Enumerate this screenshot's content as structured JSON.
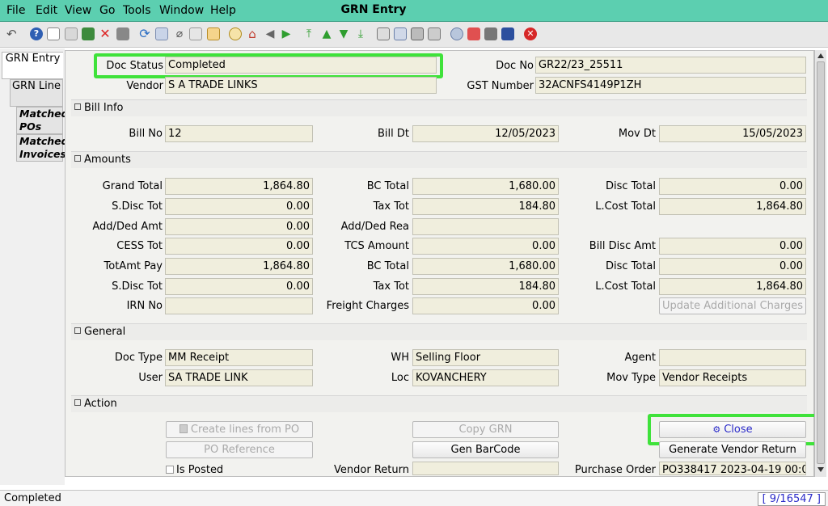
{
  "menu": {
    "file": "File",
    "edit": "Edit",
    "view": "View",
    "go": "Go",
    "tools": "Tools",
    "window": "Window",
    "help": "Help"
  },
  "window_title": "GRN Entry",
  "tabs": [
    "GRN Entry",
    "GRN Line",
    "Matched POs",
    "Matched Invoices"
  ],
  "header": {
    "doc_status_label": "Doc Status",
    "doc_status": "Completed",
    "doc_no_label": "Doc No",
    "doc_no": "GR22/23_25511",
    "vendor_label": "Vendor",
    "vendor": "S A TRADE LINKS",
    "gst_label": "GST Number",
    "gst": "32ACNFS4149P1ZH"
  },
  "bill": {
    "section": "Bill Info",
    "bill_no_label": "Bill No",
    "bill_no": "12",
    "bill_dt_label": "Bill Dt",
    "bill_dt": "12/05/2023",
    "mov_dt_label": "Mov Dt",
    "mov_dt": "15/05/2023"
  },
  "amounts": {
    "section": "Amounts",
    "grand_total_label": "Grand Total",
    "grand_total": "1,864.80",
    "bc_total_label": "BC Total",
    "bc_total": "1,680.00",
    "disc_total_label": "Disc Total",
    "disc_total": "0.00",
    "sdisc_tot_label": "S.Disc Tot",
    "sdisc_tot": "0.00",
    "tax_tot_label": "Tax Tot",
    "tax_tot": "184.80",
    "lcost_total_label": "L.Cost Total",
    "lcost_total": "1,864.80",
    "add_ded_amt_label": "Add/Ded Amt",
    "add_ded_amt": "0.00",
    "add_ded_rea_label": "Add/Ded Rea",
    "add_ded_rea": "",
    "cess_tot_label": "CESS Tot",
    "cess_tot": "0.00",
    "tcs_amount_label": "TCS Amount",
    "tcs_amount": "0.00",
    "bill_disc_amt_label": "Bill Disc Amt",
    "bill_disc_amt": "0.00",
    "totamt_pay_label": "TotAmt Pay",
    "totamt_pay": "1,864.80",
    "bc_total2_label": "BC Total",
    "bc_total2": "1,680.00",
    "disc_total2_label": "Disc Total",
    "disc_total2": "0.00",
    "sdisc_tot2_label": "S.Disc Tot",
    "sdisc_tot2": "0.00",
    "tax_tot2_label": "Tax Tot",
    "tax_tot2": "184.80",
    "lcost_total2_label": "L.Cost Total",
    "lcost_total2": "1,864.80",
    "irn_no_label": "IRN No",
    "irn_no": "",
    "freight_label": "Freight Charges",
    "freight": "0.00",
    "update_charges_label": "Update Additional Charges"
  },
  "general": {
    "section": "General",
    "doc_type_label": "Doc Type",
    "doc_type": "MM Receipt",
    "wh_label": "WH",
    "wh": "Selling Floor",
    "agent_label": "Agent",
    "agent": "",
    "user_label": "User",
    "user": "SA TRADE LINK",
    "loc_label": "Loc",
    "loc": "KOVANCHERY",
    "mov_type_label": "Mov Type",
    "mov_type": "Vendor Receipts"
  },
  "action": {
    "section": "Action",
    "create_lines_label": "Create lines from PO",
    "copy_grn_label": "Copy GRN",
    "close_label": "Close",
    "po_reference_label": "PO Reference",
    "gen_barcode_label": "Gen BarCode",
    "gen_vendor_return_label": "Generate Vendor Return",
    "is_posted_label": "Is Posted",
    "vendor_return_label": "Vendor Return",
    "vendor_return": "",
    "purchase_order_label": "Purchase Order",
    "purchase_order": "PO338417  2023-04-19 00:0"
  },
  "status": {
    "text": "Completed",
    "record_nav": "[ 9/16547 ]"
  },
  "colors": {
    "titlebar": "#5ccfb0",
    "field_bg": "#f0eedd",
    "highlight": "#3fe23a",
    "link": "#2b2bc9"
  }
}
